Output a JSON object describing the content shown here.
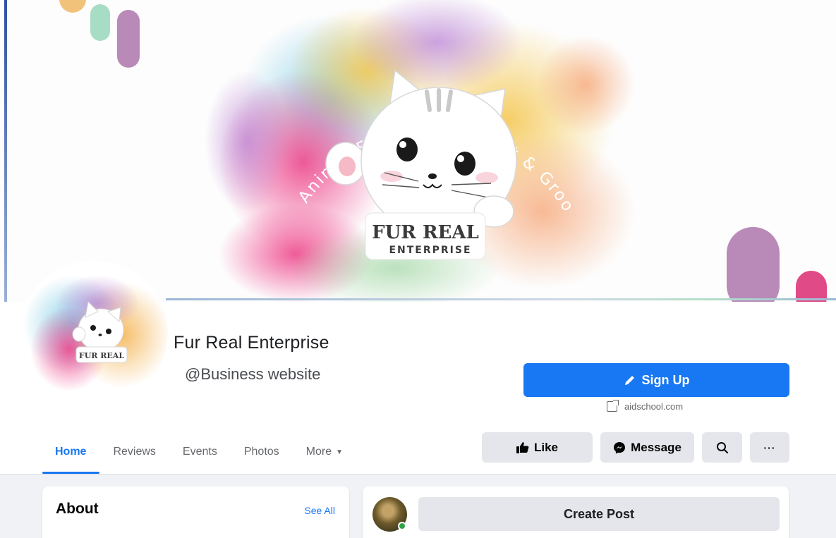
{
  "cover": {
    "arc_text": "Animal Fur Care Product & Grooming Services",
    "logo_line1": "FUR REAL",
    "logo_line2": "ENTERPRISE"
  },
  "profile": {
    "avatar_logo_text": "FUR REAL",
    "name": "Fur Real Enterprise",
    "handle": "@Business website"
  },
  "cta": {
    "signup_label": "Sign Up",
    "website": "aidschool.com"
  },
  "tabs": [
    {
      "label": "Home",
      "active": true
    },
    {
      "label": "Reviews",
      "active": false
    },
    {
      "label": "Events",
      "active": false
    },
    {
      "label": "Photos",
      "active": false
    },
    {
      "label": "More",
      "active": false,
      "has_dropdown": true
    }
  ],
  "actions": {
    "like_label": "Like",
    "message_label": "Message",
    "more_label": "···"
  },
  "about": {
    "title": "About",
    "see_all": "See All"
  },
  "composer": {
    "create_post_label": "Create Post"
  },
  "colors": {
    "accent": "#1877f2",
    "secondary_button": "#e4e6eb",
    "feed_background": "#f0f2f5",
    "online": "#31a24c"
  }
}
